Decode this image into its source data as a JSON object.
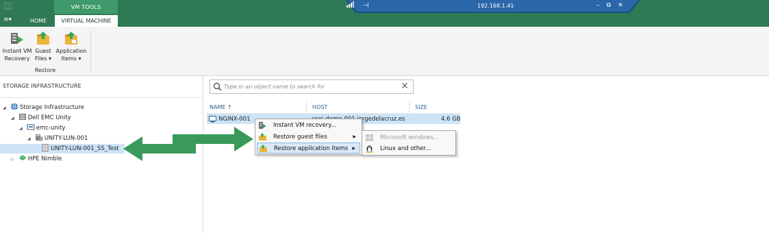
{
  "titlebar": {
    "app_icon_glyph": "⿲",
    "context_tab": "VM TOOLS",
    "ip": "192.168.1.41",
    "ghost_text": "⋯",
    "minimize": "‒",
    "restore": "⧉",
    "close": "✕"
  },
  "tabs": {
    "menu": "≡▾",
    "home": "HOME",
    "virtual_machine": "VIRTUAL MACHINE"
  },
  "ribbon": {
    "instant_line1": "Instant VM",
    "instant_line2": "Recovery",
    "guest_line1": "Guest",
    "guest_line2": "Files ▾",
    "app_line1": "Application",
    "app_line2": "Items ▾",
    "group_label": "Restore"
  },
  "left_pane": {
    "header": "STORAGE INFRASTRUCTURE",
    "tree": [
      {
        "label": "Storage Infrastructure",
        "arrow": "◢"
      },
      {
        "label": "Dell EMC Unity",
        "arrow": "◢"
      },
      {
        "label": "emc-unity",
        "arrow": "◢"
      },
      {
        "label": "UNITY-LUN-001",
        "arrow": "◢"
      },
      {
        "label": "UNITY-LUN-001_SS_Test",
        "arrow": ""
      },
      {
        "label": "HPE Nimble",
        "arrow": "▷"
      }
    ]
  },
  "search": {
    "placeholder": "Type in an object name to search for",
    "clear": "✕"
  },
  "table": {
    "col_name": "NAME ↑",
    "col_host": "HOST",
    "col_size": "SIZE",
    "row": {
      "name": "NGINX-001",
      "host": "esxi-demo-001.jorgedelacruz.es",
      "size": "4.6 GB"
    }
  },
  "context_menu": {
    "items": [
      {
        "label": "Instant VM recovery...",
        "submenu": ""
      },
      {
        "label": "Restore guest files",
        "submenu": "▶"
      },
      {
        "label": "Restore application items",
        "submenu": "▶"
      }
    ]
  },
  "submenu": {
    "items": [
      {
        "label": "Microsoft windows..."
      },
      {
        "label": "Linux and other..."
      }
    ]
  },
  "colors": {
    "brand_green": "#2f7a55",
    "context_tab_green": "#3e9a6b",
    "selection_blue": "#cde4f7",
    "arrow_green": "#3a9a5a"
  }
}
